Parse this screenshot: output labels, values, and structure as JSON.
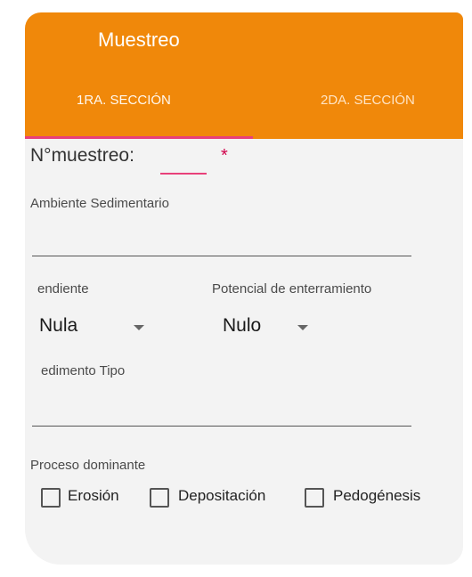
{
  "appbar": {
    "title": "Muestreo"
  },
  "tabs": [
    {
      "label": "1RA. SECCIÓN",
      "active": true
    },
    {
      "label": "2DA. SECCIÓN",
      "active": false
    }
  ],
  "form": {
    "muestreo_label": "N°muestreo:",
    "muestreo_value": "",
    "required_mark": "*",
    "ambiente_label": "Ambiente Sedimentario",
    "pendiente_label": "endiente",
    "pendiente_value": "Nula",
    "potencial_label": "Potencial de enterramiento",
    "potencial_value": "Nulo",
    "sedimento_label": "edimento Tipo",
    "proceso_label": "Proceso dominante",
    "checkboxes": [
      {
        "label": "Erosión",
        "checked": false
      },
      {
        "label": "Depositación",
        "checked": false
      },
      {
        "label": "Pedogénesis",
        "checked": false
      }
    ]
  },
  "colors": {
    "accent": "#f0880a",
    "indicator": "#e8407a",
    "required": "#d0004a"
  },
  "icons": [
    "dropdown-caret-icon",
    "checkbox-icon"
  ]
}
